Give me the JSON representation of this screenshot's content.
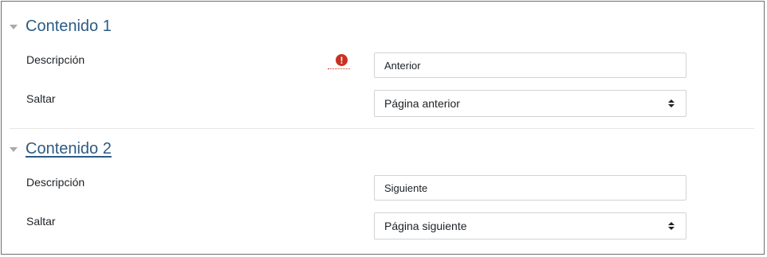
{
  "sections": [
    {
      "title": "Contenido 1",
      "fields": {
        "description_label": "Descripción",
        "description_value": "Anterior",
        "jump_label": "Saltar",
        "jump_value": "Página anterior"
      }
    },
    {
      "title": "Contenido 2",
      "fields": {
        "description_label": "Descripción",
        "description_value": "Siguiente",
        "jump_label": "Saltar",
        "jump_value": "Página siguiente"
      }
    }
  ],
  "icons": {
    "section_toggle": "caret-down-icon",
    "required": "exclamation-circle-icon",
    "select_arrows": "sort-arrows-icon"
  },
  "colors": {
    "section_title": "#2c5b84",
    "required": "#ca3120",
    "border": "#d0d3d6"
  }
}
